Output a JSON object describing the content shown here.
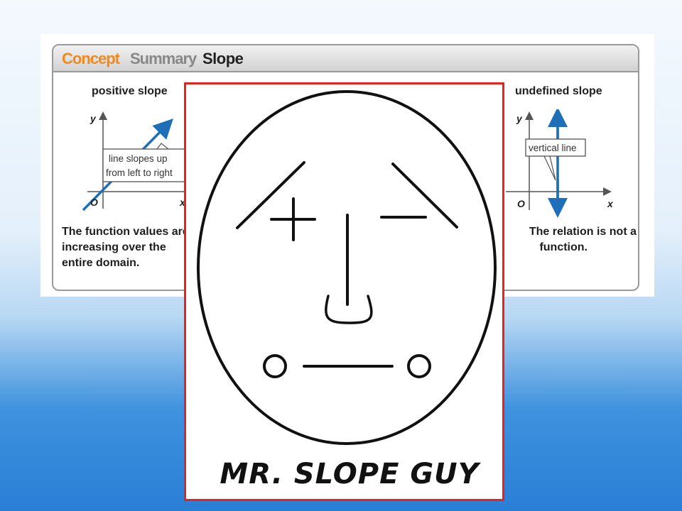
{
  "summary": {
    "header": {
      "concept": "Concept",
      "summary": "Summary",
      "topic": "Slope"
    },
    "columns": [
      {
        "title": "positive slope",
        "callout": [
          "line slopes up",
          "from left to right"
        ],
        "text": [
          "The function values are",
          "increasing over the",
          "entire domain."
        ],
        "axis": {
          "y": "y",
          "x": "x",
          "origin": "O"
        }
      },
      {
        "title": "undefined slope",
        "callout": [
          "vertical line"
        ],
        "text": [
          "The relation is not a",
          "function."
        ],
        "axis": {
          "y": "y",
          "x": "x",
          "origin": "O"
        }
      }
    ]
  },
  "face_card": {
    "caption": "MR. SLOPE GUY"
  },
  "colors": {
    "accent": "#f08a1c",
    "line_blue": "#1f6fb8",
    "frame_red": "#e8231e"
  }
}
